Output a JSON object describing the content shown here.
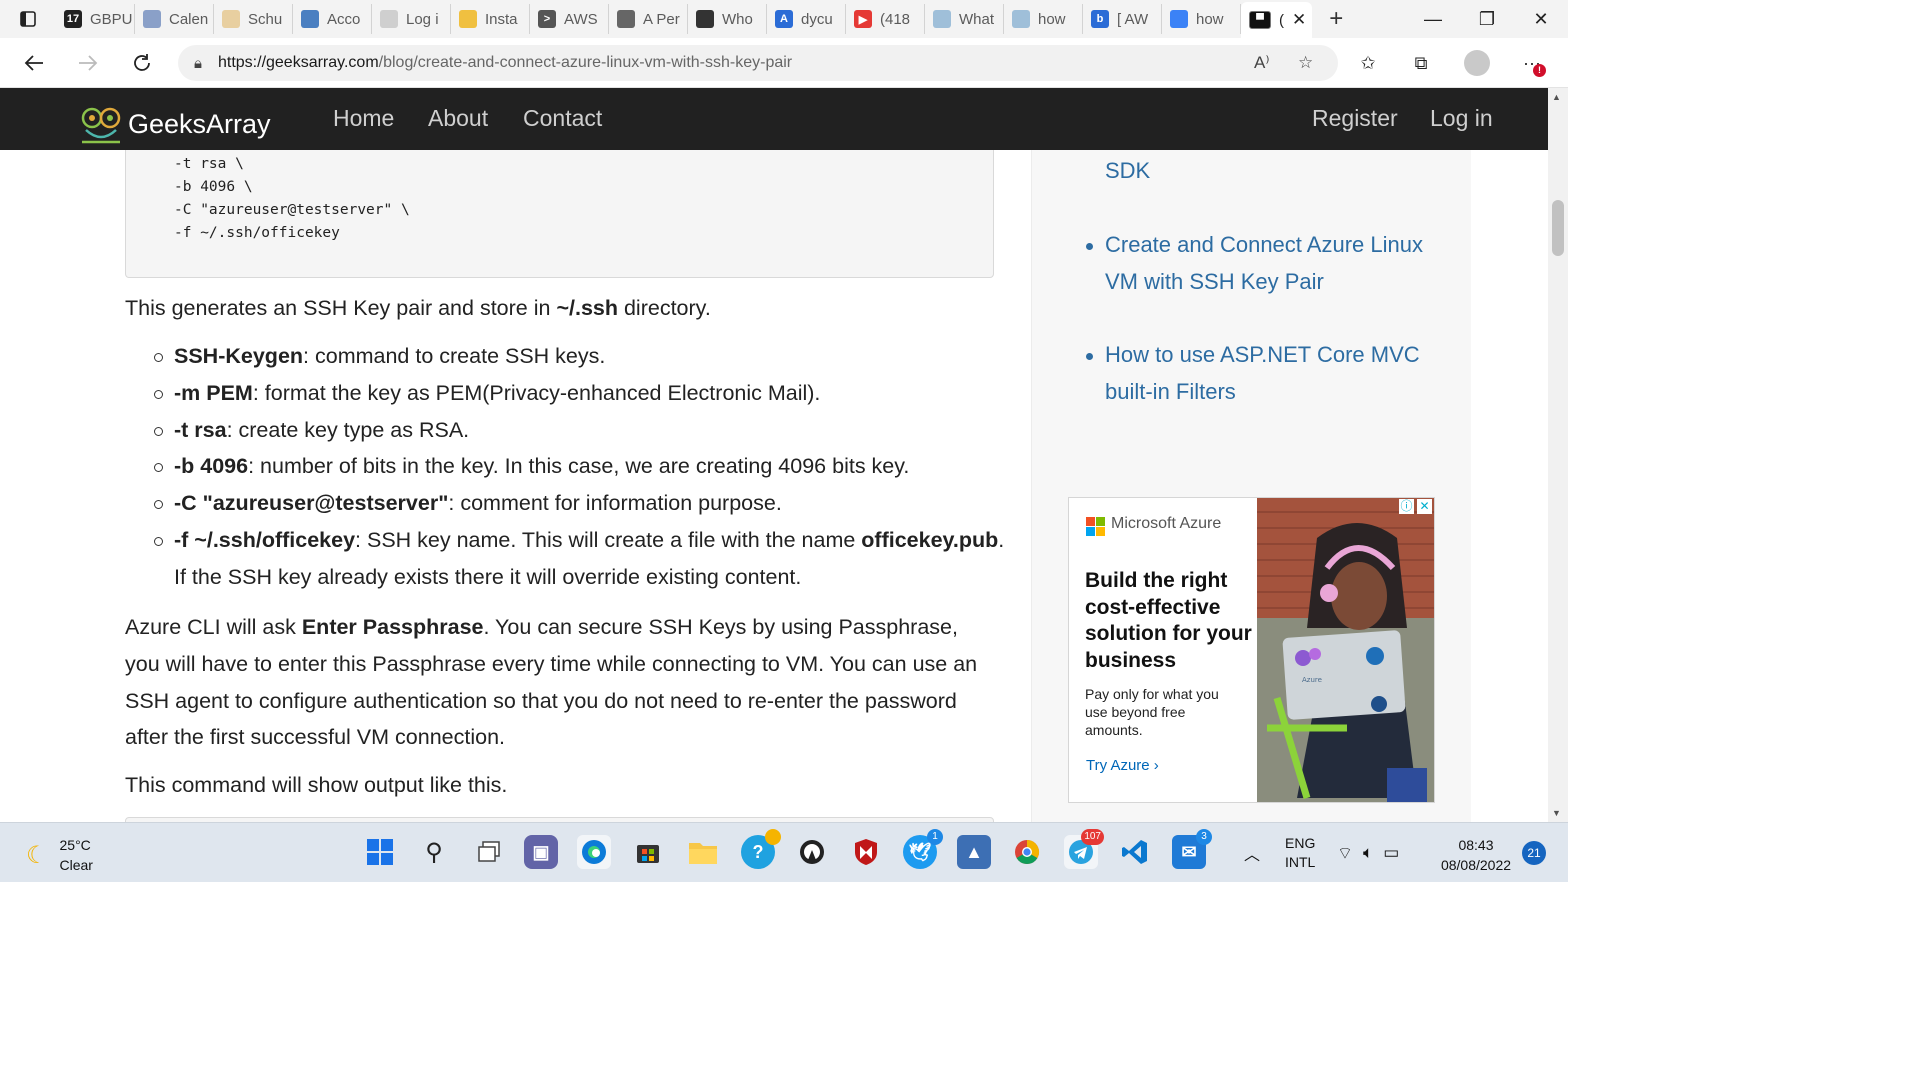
{
  "browser": {
    "tabs": [
      {
        "label": "GBPU",
        "fav": "#222222",
        "glyph": "17"
      },
      {
        "label": "Calen",
        "fav": "#8aa0c8",
        "glyph": ""
      },
      {
        "label": "Schu",
        "fav": "#e8cfa0",
        "glyph": ""
      },
      {
        "label": "Acco",
        "fav": "#4a7fc1",
        "glyph": ""
      },
      {
        "label": "Log i",
        "fav": "#cfcfcf",
        "glyph": ""
      },
      {
        "label": "Insta",
        "fav": "#f0c040",
        "glyph": ""
      },
      {
        "label": "AWS",
        "fav": "#555555",
        "glyph": ">"
      },
      {
        "label": "A Per",
        "fav": "#666666",
        "glyph": ""
      },
      {
        "label": "Who",
        "fav": "#333333",
        "glyph": ""
      },
      {
        "label": "dycu",
        "fav": "#2b6cd6",
        "glyph": "A"
      },
      {
        "label": "(418",
        "fav": "#e53935",
        "glyph": "▶"
      },
      {
        "label": "What",
        "fav": "#9fbfd9",
        "glyph": ""
      },
      {
        "label": "how",
        "fav": "#9fbfd9",
        "glyph": ""
      },
      {
        "label": "[ AW",
        "fav": "#2b6cd6",
        "glyph": "b"
      },
      {
        "label": "how",
        "fav": "#3b82f6",
        "glyph": ""
      }
    ],
    "window_controls": {
      "minimize": "—",
      "maximize": "❐",
      "close": "✕"
    },
    "url_host": "https://geeksarray.com",
    "url_path": "/blog/create-and-connect-azure-linux-vm-with-ssh-key-pair"
  },
  "site": {
    "brand": "GeeksArray",
    "nav": {
      "home": "Home",
      "about": "About",
      "contact": "Contact",
      "register": "Register",
      "login": "Log in"
    }
  },
  "article": {
    "code_lines": "-t rsa \\\n-b 4096 \\\n-C \"azureuser@testserver\" \\\n-f ~/.ssh/officekey",
    "p1_before": "This generates an SSH Key pair and store in ",
    "p1_bold": "~/.ssh",
    "p1_after": " directory.",
    "bullets": [
      {
        "bold": "SSH-Keygen",
        "text": ": command to create SSH keys."
      },
      {
        "bold": "-m PEM",
        "text": ": format the key as PEM(Privacy-enhanced Electronic Mail)."
      },
      {
        "bold": "-t rsa",
        "text": ": create key type as RSA."
      },
      {
        "bold": "-b 4096",
        "text": ": number of bits in the key. In this case, we are creating 4096 bits key."
      },
      {
        "bold": "-C \"azureuser@testserver\"",
        "text": ": comment for information purpose."
      },
      {
        "bold": "-f ~/.ssh/officekey",
        "text": ": SSH key name. This will create a file with the name "
      }
    ],
    "bullet6_bold2": "officekey.pub",
    "bullet6_after": ". If the SSH key already exists there it will override existing content.",
    "p2_before": "Azure CLI will ask ",
    "p2_bold": "Enter Passphrase",
    "p2_after": ". You can secure SSH Keys by using Passphrase, you will have to enter this Passphrase every time while connecting to VM. You can use an SSH agent to configure authentication so that you do not need to re-enter the password after the first successful VM connection.",
    "p3": "This command will show output like this."
  },
  "sidebar": {
    "links": [
      {
        "text": "SDK"
      },
      {
        "text": "Create and Connect Azure Linux VM with SSH Key Pair"
      },
      {
        "text": "How to use ASP.NET Core MVC built-in Filters"
      }
    ]
  },
  "ad": {
    "brand": "Microsoft Azure",
    "headline": "Build the right cost-effective solution for your business",
    "body": "Pay only for what you use beyond free amounts.",
    "cta": "Try Azure ›",
    "laptop_label": "Azure"
  },
  "taskbar": {
    "weather_temp": "25°C",
    "weather_desc": "Clear",
    "badges": {
      "twitter": "1",
      "telegram": "107",
      "mail": "3",
      "lightshot": ""
    },
    "lang_top": "ENG",
    "lang_bottom": "INTL",
    "time": "08:43",
    "date": "08/08/2022",
    "notifications": "21"
  }
}
